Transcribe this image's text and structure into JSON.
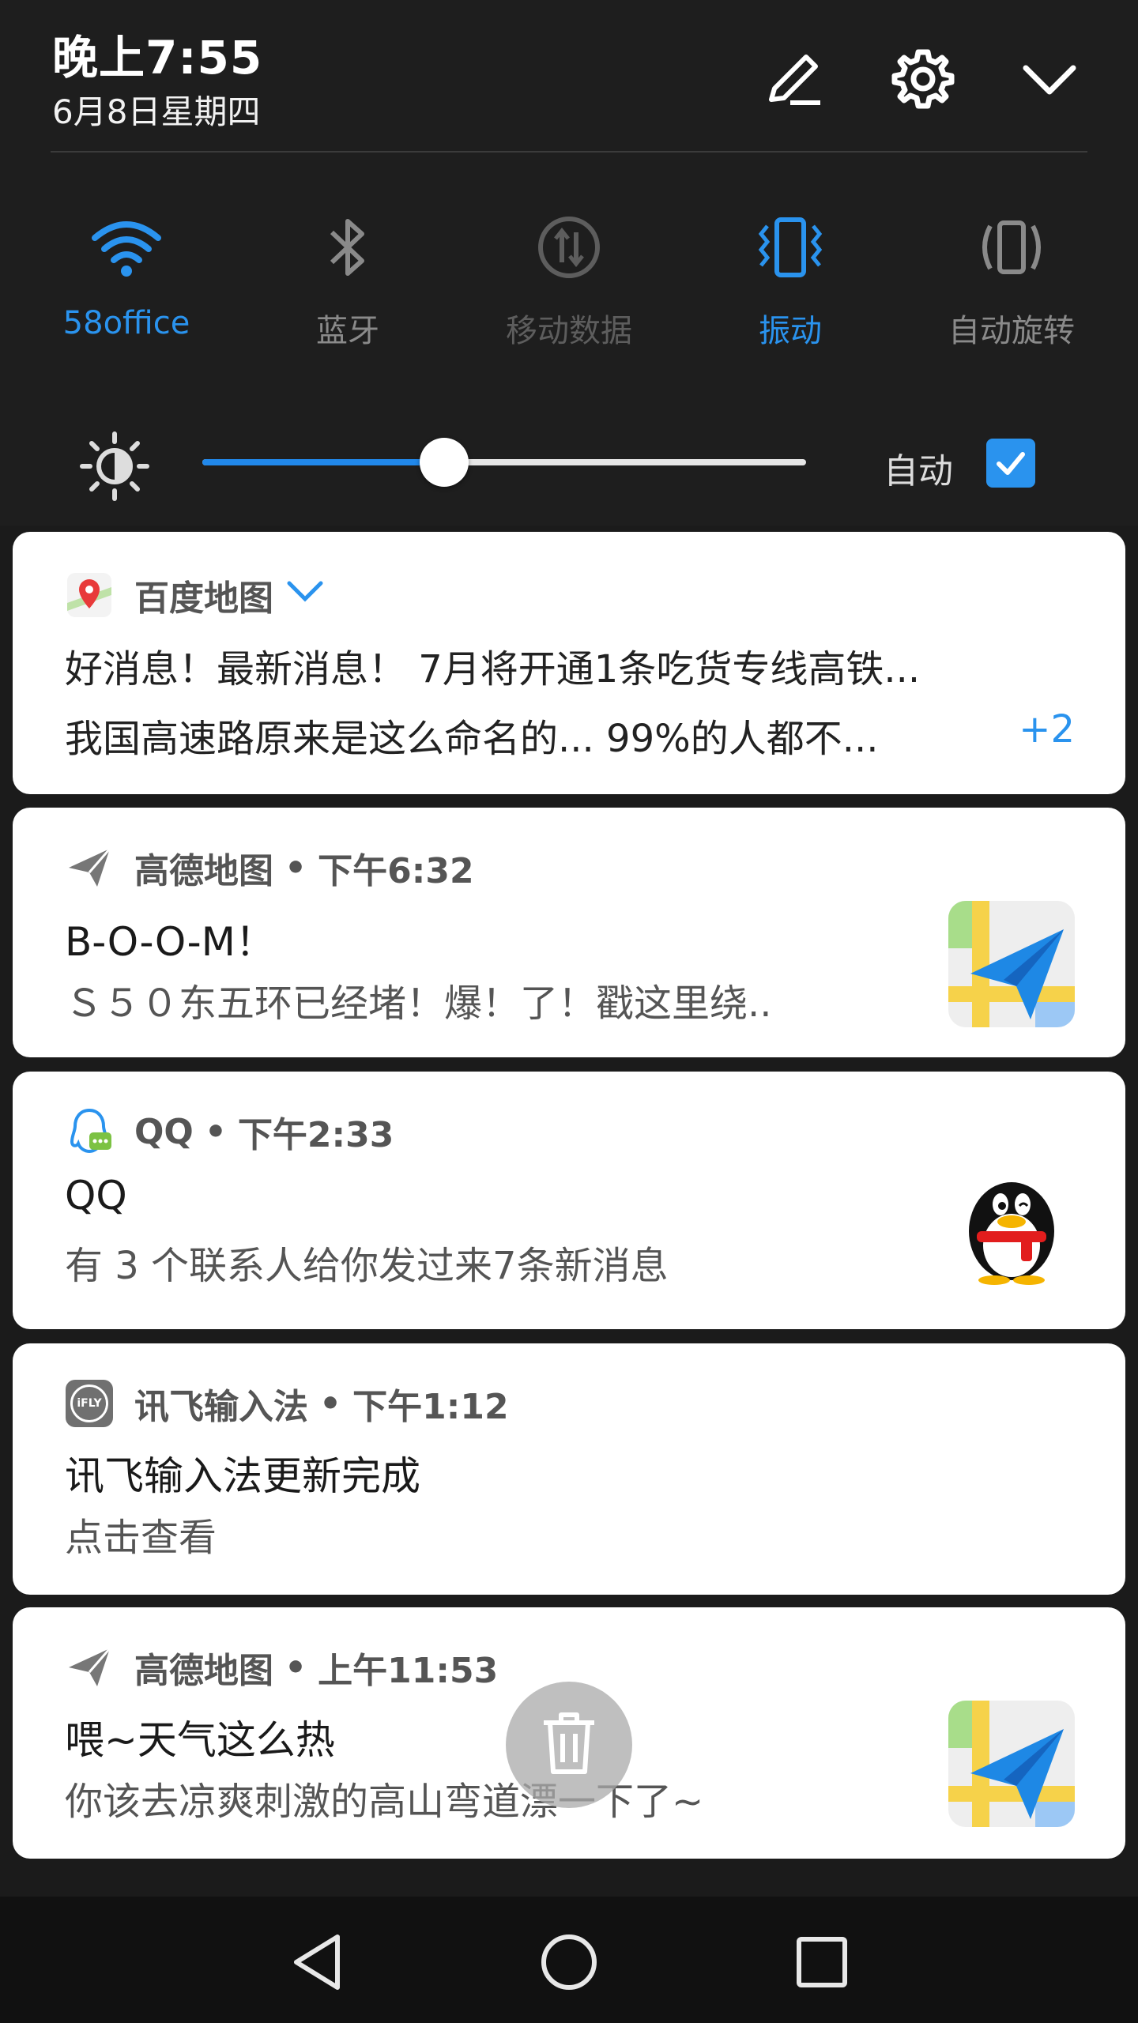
{
  "status": {
    "time": "晚上7:55",
    "date": "6月8日星期四"
  },
  "quick_settings": {
    "tiles": [
      {
        "label": "58office",
        "icon": "wifi-icon",
        "state": "on"
      },
      {
        "label": "蓝牙",
        "icon": "bluetooth-icon",
        "state": "off"
      },
      {
        "label": "移动数据",
        "icon": "mobile-data-icon",
        "state": "dim"
      },
      {
        "label": "振动",
        "icon": "vibrate-icon",
        "state": "on"
      },
      {
        "label": "自动旋转",
        "icon": "auto-rotate-icon",
        "state": "off"
      }
    ],
    "brightness": {
      "level": 0.4,
      "auto_label": "自动",
      "auto_checked": true
    },
    "accent_color": "#2a93ee"
  },
  "notifications": [
    {
      "app": "百度地图",
      "icon": "baidu-map-icon",
      "lines": [
        "好消息！最新消息！ 7月将开通1条吃货专线高铁...",
        "我国高速路原来是这么命名的... 99%的人都不..."
      ],
      "more": "+2"
    },
    {
      "app": "高德地图",
      "time": "下午6:32",
      "icon": "amap-send-icon",
      "title": "B-O-O-M！",
      "body": "Ｓ５０东五环已经堵！爆！了！戳这里绕.."
    },
    {
      "app": "QQ",
      "time": "下午2:33",
      "icon": "qq-icon",
      "title": "QQ",
      "body": "有 3 个联系人给你发过来7条新消息"
    },
    {
      "app": "讯飞输入法",
      "time": "下午1:12",
      "icon": "ifly-icon",
      "icon_text": "iFLY",
      "title": "讯飞输入法更新完成",
      "body": "点击查看"
    },
    {
      "app": "高德地图",
      "time": "上午11:53",
      "icon": "amap-send-icon",
      "title": "喂~天气这么热",
      "body": "你该去凉爽刺激的高山弯道漂一下了~"
    }
  ],
  "separator": "•"
}
